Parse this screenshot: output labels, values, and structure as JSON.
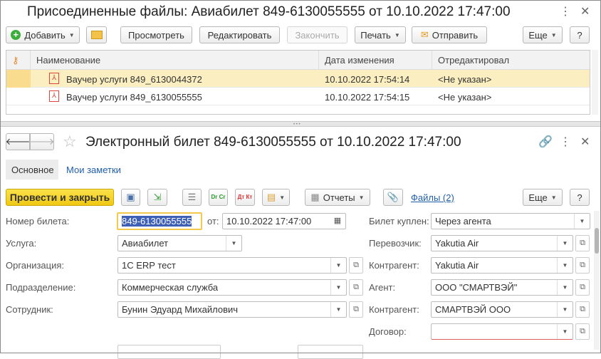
{
  "files_window": {
    "title": "Присоединенные файлы: Авиабилет 849-6130055555 от 10.10.2022 17:47:00",
    "toolbar": {
      "add": "Добавить",
      "view": "Просмотреть",
      "edit": "Редактировать",
      "finish": "Закончить",
      "print": "Печать",
      "send": "Отправить",
      "more": "Еще",
      "help": "?"
    },
    "columns": [
      "Наименование",
      "Дата изменения",
      "Отредактировал"
    ],
    "rows": [
      {
        "name": "Ваучер услуги 849_6130044372",
        "date": "10.10.2022 17:54:14",
        "editor": "<Не указан>",
        "selected": true
      },
      {
        "name": "Ваучер услуги 849_6130055555",
        "date": "10.10.2022 17:54:15",
        "editor": "<Не указан>",
        "selected": false
      }
    ]
  },
  "doc_window": {
    "title": "Электронный билет 849-6130055555 от 10.10.2022 17:47:00",
    "tabs": [
      "Основное",
      "Мои заметки"
    ],
    "toolbar": {
      "post_close": "Провести и закрыть",
      "dr_cr": "Dr Cr",
      "dt_kt": "Дт Кт",
      "reports": "Отчеты",
      "files": "Файлы (2)",
      "more": "Еще",
      "help": "?"
    },
    "form": {
      "ticket_label": "Номер билета:",
      "ticket_value": "849-6130055555",
      "from_label": "от:",
      "from_value": "10.10.2022 17:47:00",
      "service_label": "Услуга:",
      "service_value": "Авиабилет",
      "org_label": "Организация:",
      "org_value": "1С ERP тест",
      "dept_label": "Подразделение:",
      "dept_value": "Коммерческая служба",
      "employee_label": "Сотрудник:",
      "employee_value": "Бунин Эдуард Михайлович",
      "bought_label": "Билет куплен:",
      "bought_value": "Через агента",
      "carrier_label": "Перевозчик:",
      "carrier_value": "Yakutia Air",
      "counterparty1_label": "Контрагент:",
      "counterparty1_value": "Yakutia Air",
      "agent_label": "Агент:",
      "agent_value": "ООО \"СМАРТВЭЙ\"",
      "counterparty2_label": "Контрагент:",
      "counterparty2_value": "СМАРТВЭЙ ООО",
      "contract_label": "Договор:",
      "contract_value": ""
    }
  },
  "colors": {
    "accent_yellow": "#f7d52a",
    "selected_row": "#fbeec0",
    "link": "#1f5fae"
  }
}
